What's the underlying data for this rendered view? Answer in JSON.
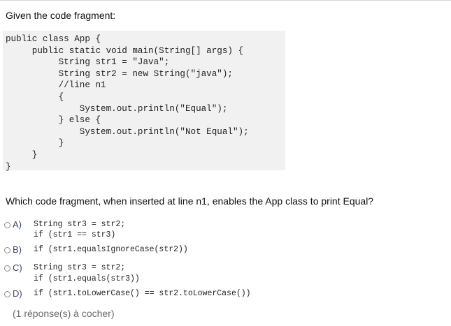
{
  "heading": "Given the code fragment:",
  "code_block": "public class App {\n     public static void main(String[] args) {\n          String str1 = \"Java\";\n          String str2 = new String(\"java\");\n          //line n1\n          {\n              System.out.println(\"Equal\");\n          } else {\n              System.out.println(\"Not Equal\");\n          }\n     }\n}",
  "question": "Which code fragment, when inserted at line n1, enables the App class to print Equal?",
  "options": [
    {
      "letter": "A)",
      "code": "String str3 = str2;\nif (str1 == str3)"
    },
    {
      "letter": "B)",
      "code": "if (str1.equalsIgnoreCase(str2))"
    },
    {
      "letter": "C)",
      "code": "String str3 = str2;\nif (str1.equals(str3))"
    },
    {
      "letter": "D)",
      "code": "if (str1.toLowerCase() == str2.toLowerCase())"
    }
  ],
  "hint": "(1 réponse(s) à cocher)"
}
